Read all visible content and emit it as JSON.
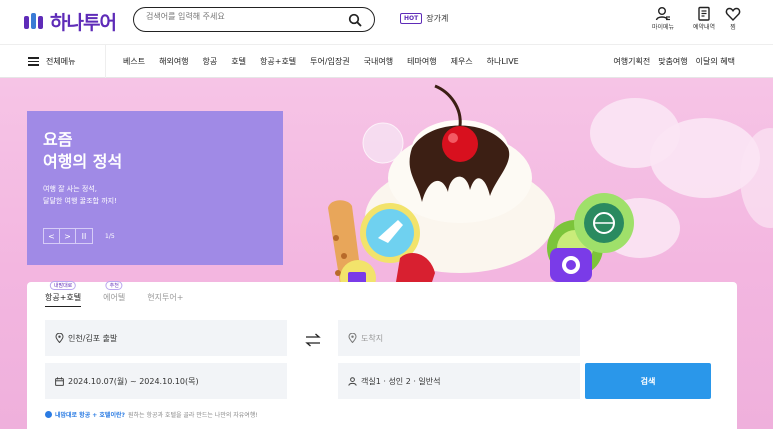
{
  "header": {
    "logo_text": "하나투어",
    "search_placeholder": "검색어를 입력해 주세요",
    "hot_badge": "HOT",
    "hot_label": "장가계",
    "util": [
      {
        "label": "마이메뉴",
        "icon": "user-icon"
      },
      {
        "label": "예약내역",
        "icon": "document-icon"
      },
      {
        "label": "찜",
        "icon": "heart-icon"
      }
    ]
  },
  "nav": {
    "menu_label": "전체메뉴",
    "items": [
      "베스트",
      "해외여행",
      "항공",
      "호텔",
      "항공+호텔",
      "투어/입장권",
      "국내여행",
      "테마여행",
      "제우스",
      "하나LIVE"
    ],
    "right_items": [
      "여행기획전",
      "맞춤여행",
      "이달의 혜택"
    ]
  },
  "promo": {
    "title_line1": "요즘",
    "title_line2": "여행의 정석",
    "sub_line1": "여행 잘 사는 정석,",
    "sub_line2": "달달한 여행 꿀조합 까지!",
    "prev": "<",
    "next": ">",
    "pause": "II",
    "page": "1/5"
  },
  "panel": {
    "tabs": [
      {
        "label": "항공+호텔",
        "tag": "내맘대로"
      },
      {
        "label": "에어텔",
        "tag": "추천"
      },
      {
        "label": "현지투어+",
        "tag": ""
      }
    ],
    "departure": "인천/김포 출발",
    "arrival_placeholder": "도착지",
    "dates": "2024.10.07(월) ~ 2024.10.10(목)",
    "rooms": "객실1 · 성인 2 · 일반석",
    "search_button": "검색",
    "note_bold": "내맘대로 항공 + 호텔이란?",
    "note_text": "원하는 항공과 호텔을 골라 만드는 나만의 자유여행!"
  },
  "colors": {
    "brand": "#5e2bb8",
    "promo_bg": "#a08ae6",
    "hero_bg": "#f3b6e0",
    "search_button": "#2a97ea"
  }
}
